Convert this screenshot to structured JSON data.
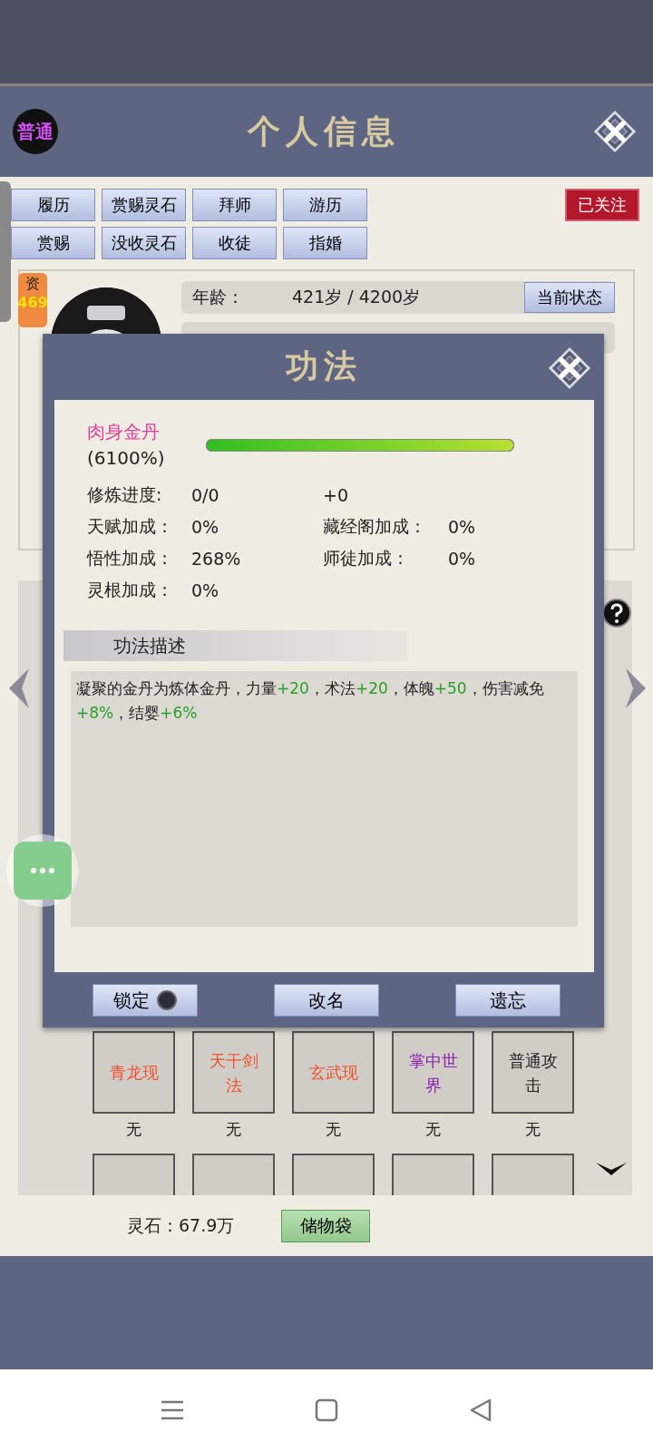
{
  "header": {
    "rank_badge": "普通",
    "title": "个人信息"
  },
  "action_buttons": [
    "履历",
    "赏赐灵石",
    "拜师",
    "游历",
    "赏赐",
    "没收灵石",
    "收徒",
    "指婚"
  ],
  "follow_stamp": "已关注",
  "profile": {
    "aptitude_label": "资",
    "aptitude_value": "469",
    "age_label": "年龄：",
    "age_value": "421岁 / 4200岁",
    "status_button": "当前状态"
  },
  "dialog": {
    "title": "功法",
    "technique_name": "肉身金丹",
    "technique_percent": "(6100%)",
    "level": 1,
    "stats": [
      {
        "label": "修炼进度:",
        "value": "0/0"
      },
      {
        "value": "+0"
      },
      {
        "label": "天赋加成：",
        "value": "0%"
      },
      {
        "label": "藏经阁加成：",
        "value": "0%"
      },
      {
        "label": "悟性加成：",
        "value": "268%"
      },
      {
        "label": "师徒加成：",
        "value": "0%"
      },
      {
        "label": "灵根加成：",
        "value": "0%"
      }
    ],
    "description_title": "功法描述",
    "description": [
      {
        "text": "凝聚的金丹为炼体金丹，力量",
        "highlight": false
      },
      {
        "text": "+20",
        "highlight": true
      },
      {
        "text": "，术法",
        "highlight": false
      },
      {
        "text": "+20",
        "highlight": true
      },
      {
        "text": "，体魄",
        "highlight": false
      },
      {
        "text": "+50",
        "highlight": true
      },
      {
        "text": "，伤害减免",
        "highlight": false
      },
      {
        "text": "+8%",
        "highlight": true
      },
      {
        "text": "，结婴",
        "highlight": false
      },
      {
        "text": "+6%",
        "highlight": true
      }
    ],
    "buttons": [
      {
        "label": "锁定",
        "kind": "toggle",
        "on": false
      },
      {
        "label": "改名",
        "kind": "plain"
      },
      {
        "label": "遗忘",
        "kind": "plain"
      }
    ]
  },
  "skills": [
    {
      "name": "青龙现",
      "color": "#f05030",
      "slot": "无"
    },
    {
      "name": "天干剑法",
      "color": "#f05030",
      "slot": "无"
    },
    {
      "name": "玄武现",
      "color": "#f05030",
      "slot": "无"
    },
    {
      "name": "掌中世界",
      "color": "#9020b0",
      "slot": "无"
    },
    {
      "name": "普通攻击",
      "color": "#222222",
      "slot": "无"
    }
  ],
  "footer": {
    "spirit_stones": "灵石：67.9万",
    "bag_button": "储物袋"
  }
}
